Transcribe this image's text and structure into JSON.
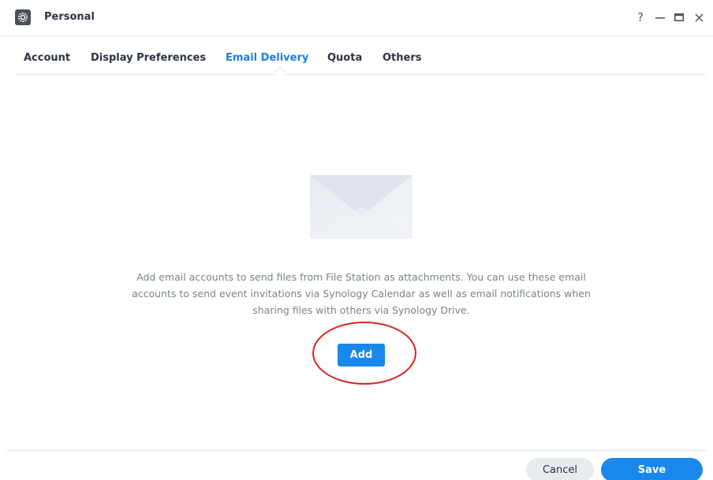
{
  "window": {
    "title": "Personal",
    "controls": {
      "help": "?",
      "minimize": "—",
      "maximize": "□",
      "close": "✕"
    }
  },
  "tabs": [
    {
      "label": "Account",
      "active": false
    },
    {
      "label": "Display Preferences",
      "active": false
    },
    {
      "label": "Email Delivery",
      "active": true
    },
    {
      "label": "Quota",
      "active": false
    },
    {
      "label": "Others",
      "active": false
    }
  ],
  "main": {
    "illustration": "envelope-icon",
    "description_lines": [
      "Add email accounts to send files from File Station as attachments. You can use these email",
      "accounts to send event invitations via Synology Calendar as well as email notifications when",
      "sharing files with others via Synology Drive."
    ],
    "add_label": "Add"
  },
  "footer": {
    "cancel_label": "Cancel",
    "save_label": "Save"
  },
  "colors": {
    "accent": "#1a87eb",
    "active_tab": "#1a7fe0",
    "highlight_ring": "#d9231e"
  }
}
